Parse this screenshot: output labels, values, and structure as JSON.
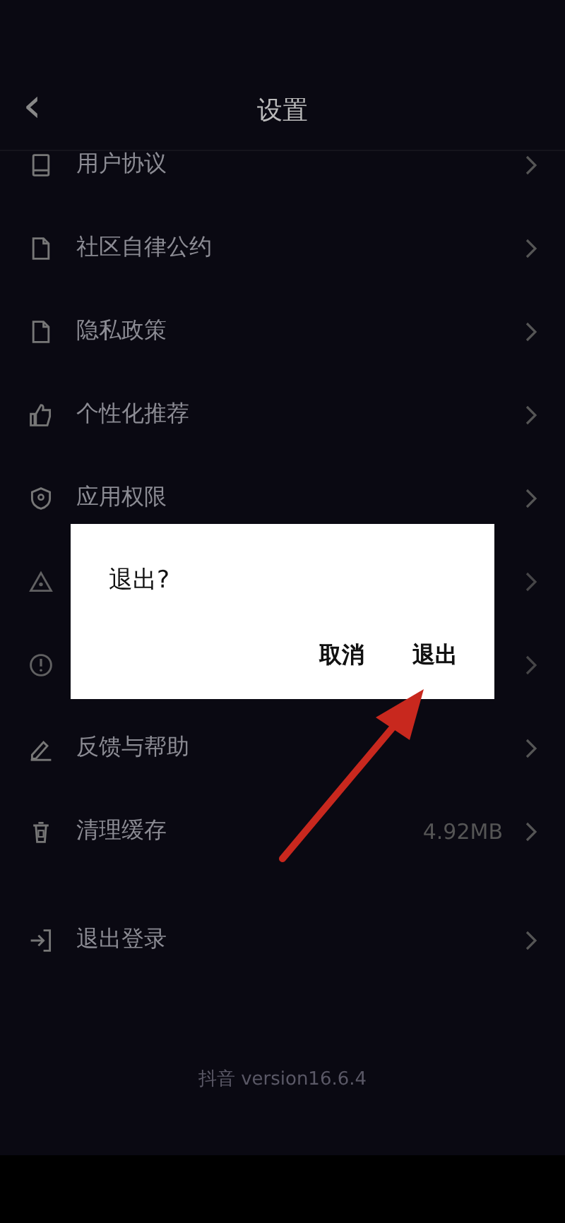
{
  "header": {
    "back": "‹",
    "title": "设置"
  },
  "settings": [
    {
      "label": "用户协议"
    },
    {
      "label": "社区自律公约"
    },
    {
      "label": "隐私政策"
    },
    {
      "label": "个性化推荐"
    },
    {
      "label": "应用权限"
    },
    {
      "kind": "covered"
    },
    {
      "kind": "covered"
    },
    {
      "label": "反馈与帮助"
    },
    {
      "label": "清理缓存",
      "value": "4.92MB"
    }
  ],
  "logout": {
    "label": "退出登录"
  },
  "version": "抖音 version16.6.4",
  "dialog": {
    "title": "退出?",
    "buttons": [
      "取消",
      "退出"
    ]
  }
}
